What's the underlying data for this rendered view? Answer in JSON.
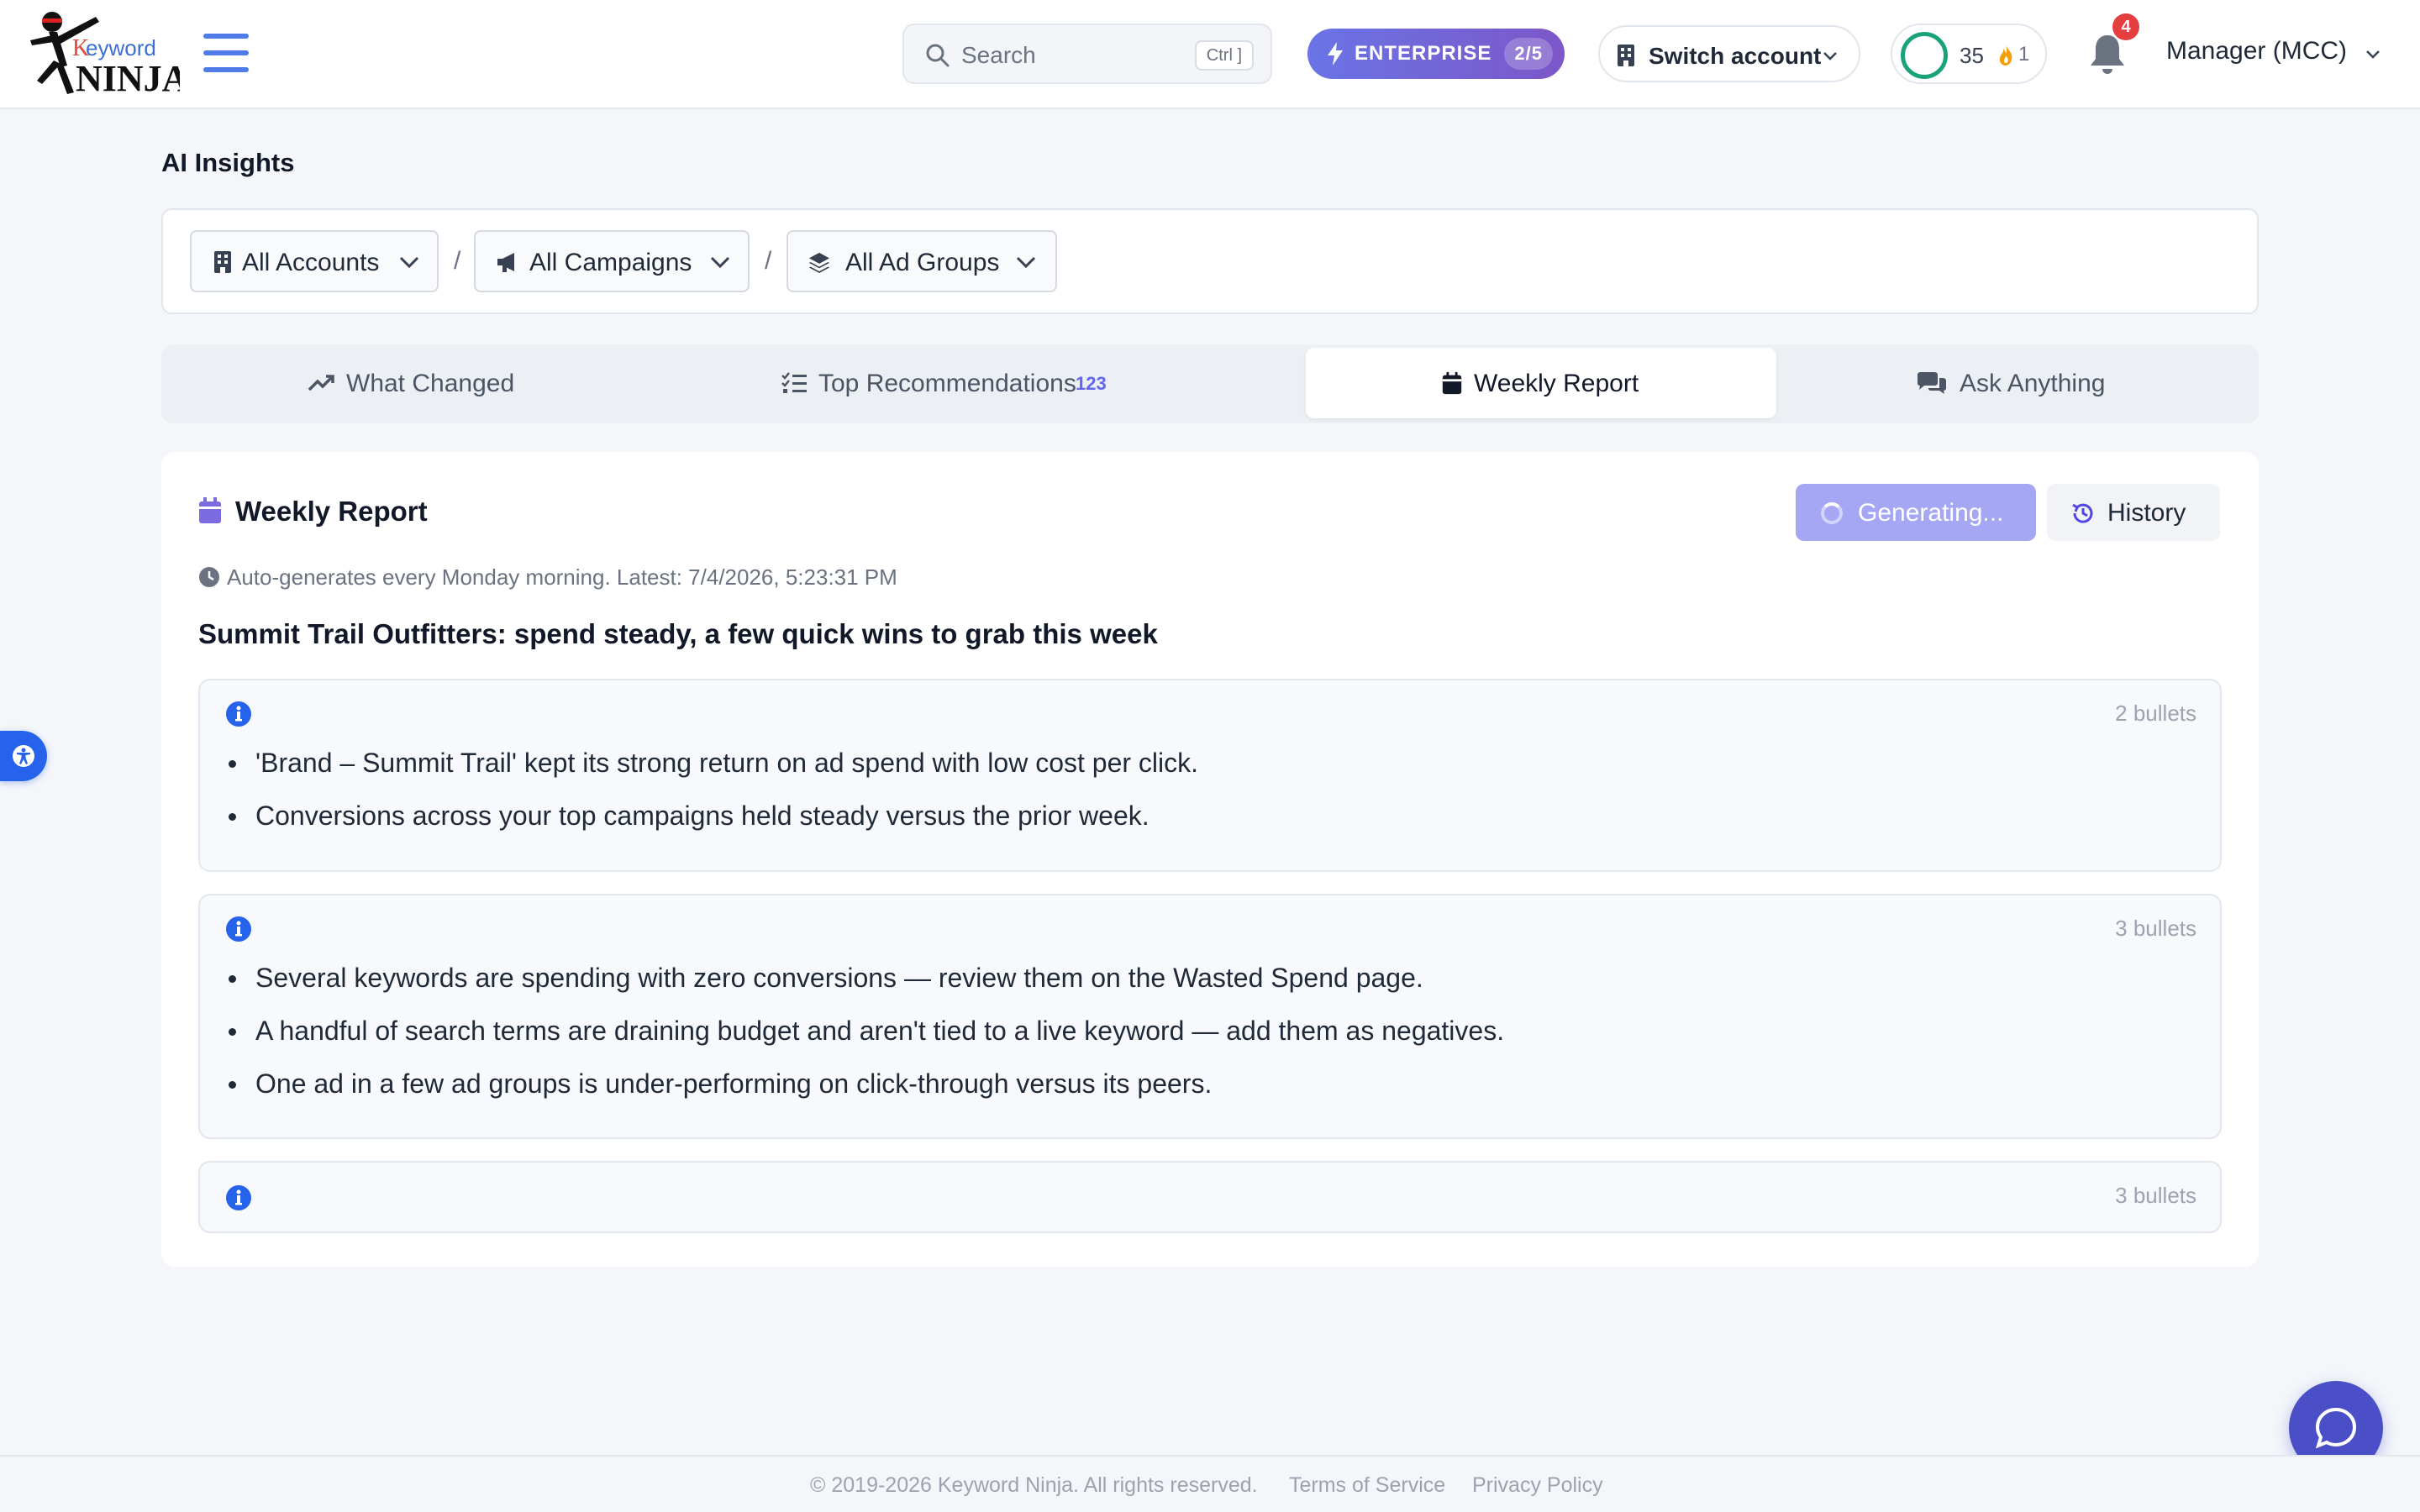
{
  "header": {
    "logo_alt": "Keyword Ninja",
    "search_placeholder": "Search",
    "search_shortcut": "Ctrl ]",
    "plan_label": "ENTERPRISE",
    "plan_count": "2/5",
    "switch_account_label": "Switch account",
    "score": "35",
    "streak": "1",
    "notifications_count": "4",
    "user_label": "Manager (MCC)",
    "icons": [
      "menu-icon",
      "search-icon",
      "bolt-icon",
      "building-icon",
      "chevron-down-icon",
      "fire-icon",
      "bell-icon"
    ]
  },
  "page": {
    "title": "AI Insights"
  },
  "filters": {
    "accounts": "All Accounts",
    "campaigns": "All Campaigns",
    "ad_groups": "All Ad Groups",
    "separator": "/"
  },
  "tabs": [
    {
      "label": "What Changed",
      "icon": "trend-up-icon",
      "active": false
    },
    {
      "label": "Top Recommendations",
      "icon": "list-check-icon",
      "count": "123",
      "active": false
    },
    {
      "label": "Weekly Report",
      "icon": "calendar-icon",
      "active": true
    },
    {
      "label": "Ask Anything",
      "icon": "comments-icon",
      "active": false
    }
  ],
  "report": {
    "title": "Weekly Report",
    "generate_label": "Generating...",
    "history_label": "History",
    "subtitle": "Auto-generates every Monday morning. Latest: 7/4/2026, 5:23:31 PM",
    "headline": "Summit Trail Outfitters: spend steady, a few quick wins to grab this week",
    "sections": [
      {
        "count_label": "2 bullets",
        "bullets": [
          "'Brand – Summit Trail' kept its strong return on ad spend with low cost per click.",
          "Conversions across your top campaigns held steady versus the prior week."
        ]
      },
      {
        "count_label": "3 bullets",
        "bullets": [
          "Several keywords are spending with zero conversions — review them on the Wasted Spend page.",
          "A handful of search terms are draining budget and aren't tied to a live keyword — add them as negatives.",
          "One ad in a few ad groups is under-performing on click-through versus its peers."
        ]
      },
      {
        "count_label": "3 bullets",
        "bullets": []
      }
    ]
  },
  "footer": {
    "copyright": "© 2019-2026 Keyword Ninja. All rights reserved.",
    "terms": "Terms of Service",
    "privacy": "Privacy Policy"
  },
  "colors": {
    "accent": "#6366f1",
    "primary_blue": "#2563eb",
    "success": "#1aa37a",
    "danger": "#e53e3e",
    "background": "#f4f6fa"
  }
}
